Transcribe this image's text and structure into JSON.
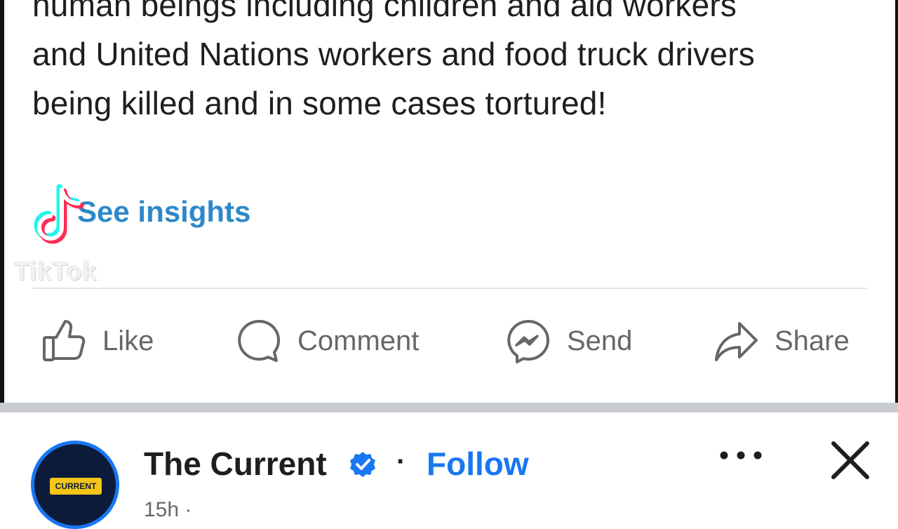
{
  "post": {
    "lines": [
      "human beings including children and aid workers",
      "and United Nations workers and food truck drivers",
      "being killed and in some cases tortured!"
    ],
    "insights_link": "See insights"
  },
  "watermark": {
    "brand": "TikTok",
    "icon": "tiktok-logo-icon"
  },
  "actions": [
    {
      "label": "Like",
      "icon": "thumbs-up-icon"
    },
    {
      "label": "Comment",
      "icon": "comment-bubble-icon"
    },
    {
      "label": "Send",
      "icon": "messenger-icon"
    },
    {
      "label": "Share",
      "icon": "share-arrow-icon"
    }
  ],
  "next_post": {
    "page_name": "The Current",
    "separator": "·",
    "follow_label": "Follow",
    "avatar_text": "CURRENT",
    "meta_peek": "15h ·",
    "verified_icon": "verified-badge-icon",
    "more_icon": "more-options-icon",
    "close_icon": "close-icon"
  },
  "colors": {
    "link_blue": "#2d88c9",
    "brand_blue": "#1877f2",
    "action_gray": "#65676b",
    "text": "#1c1e21"
  }
}
